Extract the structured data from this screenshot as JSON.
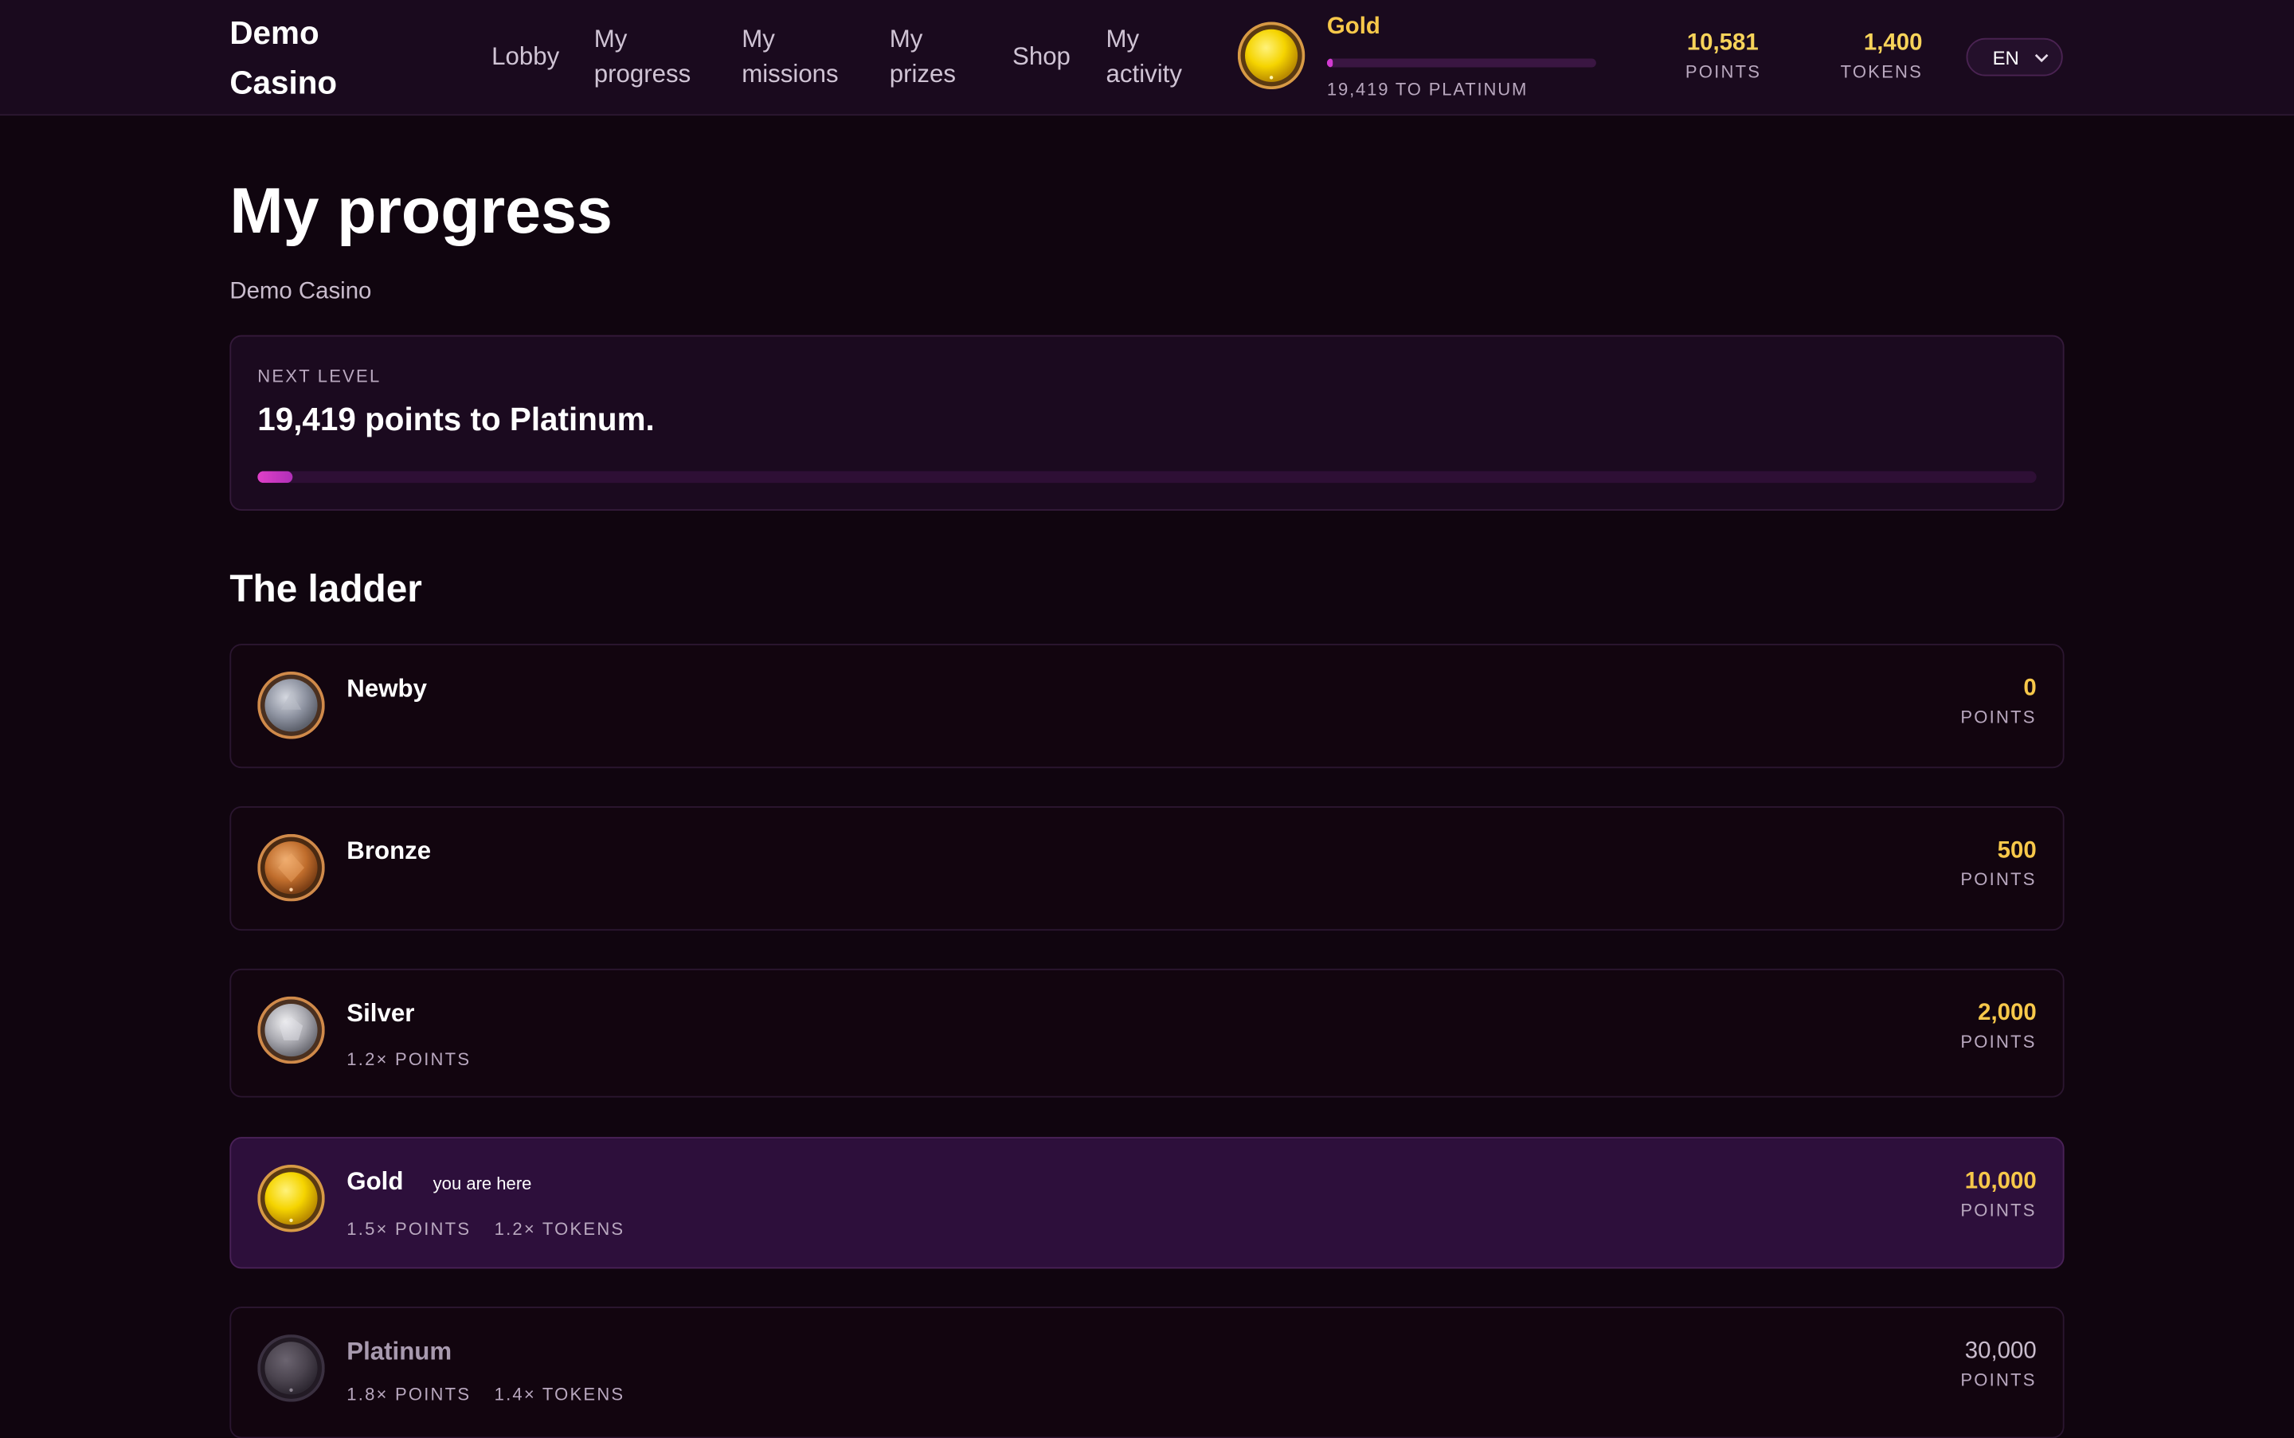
{
  "header": {
    "brand_line1": "Demo",
    "brand_line2": "Casino",
    "nav": [
      {
        "l1": "Lobby",
        "l2": ""
      },
      {
        "l1": "My",
        "l2": "progress"
      },
      {
        "l1": "My",
        "l2": "missions"
      },
      {
        "l1": "My",
        "l2": "prizes"
      },
      {
        "l1": "Shop",
        "l2": ""
      },
      {
        "l1": "My",
        "l2": "activity"
      }
    ],
    "tier_name": "Gold",
    "tier_progress": 0.02,
    "tier_sub": "19,419 TO PLATINUM",
    "points_value": "10,581",
    "points_label": "POINTS",
    "tokens_value": "1,400",
    "tokens_label": "TOKENS",
    "language": "EN"
  },
  "main": {
    "title": "My progress",
    "subtitle": "Demo Casino",
    "next_level_label": "NEXT LEVEL",
    "next_level_text": "19,419 points to Platinum.",
    "next_level_progress": 0.02,
    "ladder_title": "The ladder",
    "tiers": [
      {
        "name": "Newby",
        "points": "0",
        "points_label": "POINTS",
        "perk1": "",
        "perk2": "",
        "here": ""
      },
      {
        "name": "Bronze",
        "points": "500",
        "points_label": "POINTS",
        "perk1": "",
        "perk2": "",
        "here": ""
      },
      {
        "name": "Silver",
        "points": "2,000",
        "points_label": "POINTS",
        "perk1": "1.2× POINTS",
        "perk2": "",
        "here": ""
      },
      {
        "name": "Gold",
        "points": "10,000",
        "points_label": "POINTS",
        "perk1": "1.5× POINTS",
        "perk2": "1.2× TOKENS",
        "here": "you are here"
      },
      {
        "name": "Platinum",
        "points": "30,000",
        "points_label": "POINTS",
        "perk1": "1.8× POINTS",
        "perk2": "1.4× TOKENS",
        "here": ""
      }
    ]
  },
  "colors": {
    "background": "#10050f",
    "accent": "#d23bd1",
    "gold": "#f7c84a",
    "current_tier_bg": "#2d0f3b"
  },
  "icons": {
    "newby": "newby-tier-coin-icon",
    "bronze": "bronze-tier-coin-icon",
    "silver": "silver-tier-coin-icon",
    "gold": "gold-tier-coin-icon",
    "platinum": "platinum-tier-coin-icon",
    "chevron": "chevron-down-icon"
  }
}
